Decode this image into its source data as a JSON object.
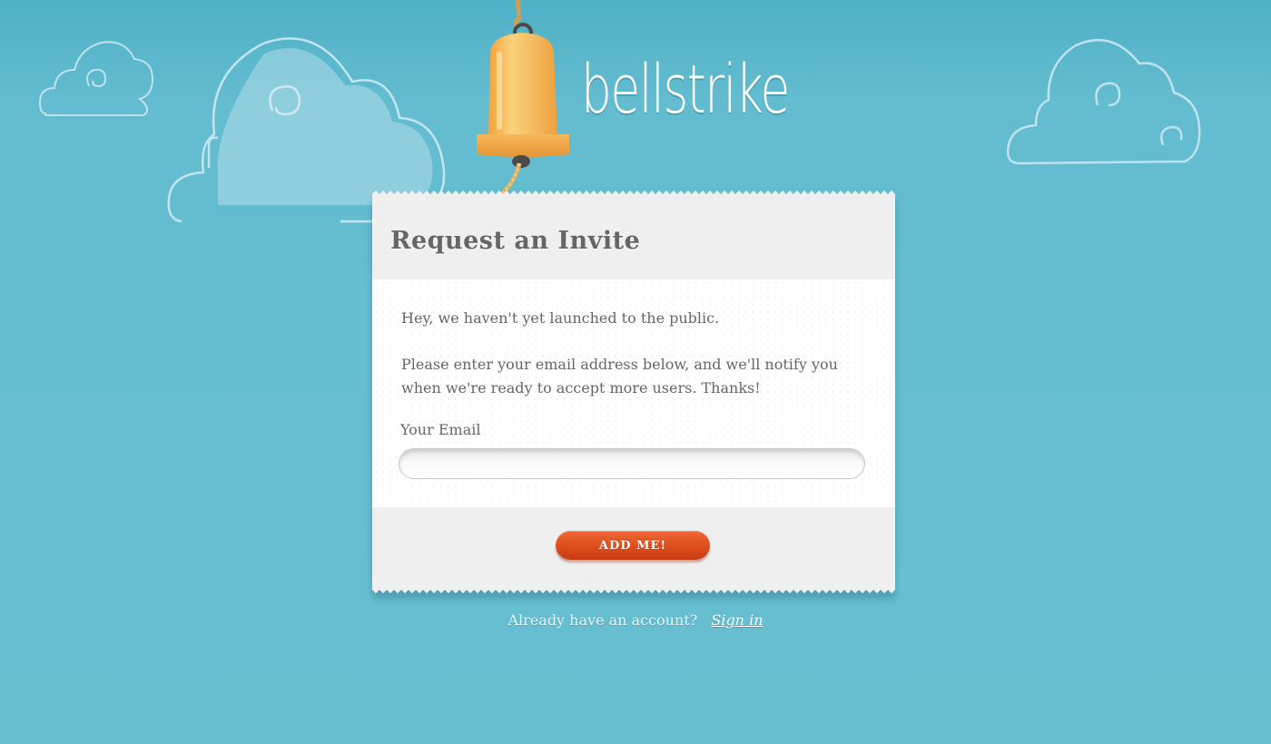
{
  "brand": {
    "name": "bellstrike"
  },
  "card": {
    "title": "Request an Invite",
    "intro": "Hey, we haven't yet launched to the public.",
    "message": "Please enter your email address below, and we'll notify you when we're ready to accept more users. Thanks!",
    "email_label": "Your Email",
    "email_value": "",
    "email_placeholder": "",
    "submit_label": "ADD ME!"
  },
  "footer": {
    "question": "Already have an account?",
    "signin_label": "Sign in"
  },
  "colors": {
    "background": "#63bcd0",
    "bell": "#f5b24a",
    "button": "#dc4a1c",
    "card": "#efefef"
  },
  "icons": [
    "cloud-icon",
    "bell-icon"
  ]
}
